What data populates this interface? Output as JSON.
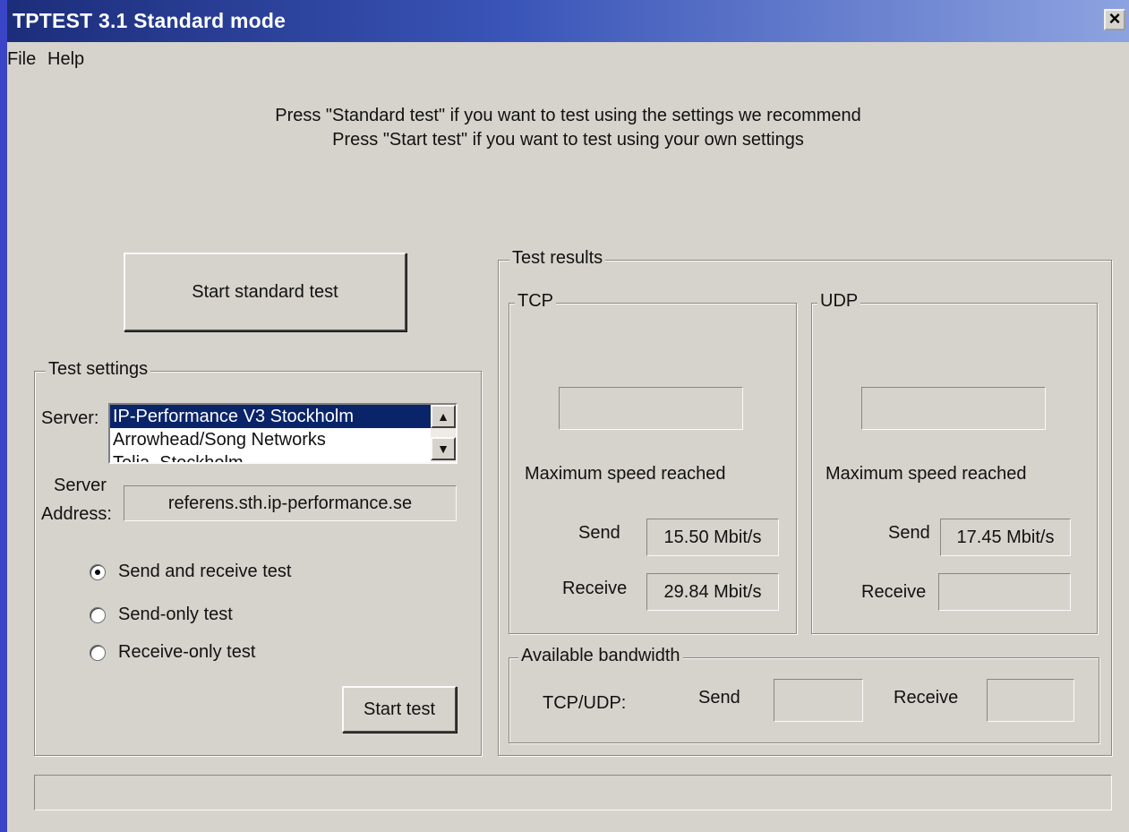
{
  "window": {
    "title": "TPTEST 3.1 Standard mode",
    "close_label": "×"
  },
  "menu": {
    "file": "File",
    "help": "Help"
  },
  "instructions": [
    "Press \"Standard test\" if you want to test using the settings we recommend",
    "Press \"Start test\" if you want to test using your own settings"
  ],
  "standard_button": "Start standard test",
  "settings": {
    "legend": "Test settings",
    "server_label": "Server:",
    "servers": [
      "IP-Performance V3 Stockholm",
      "Arrowhead/Song Networks",
      "Telia, Stockholm"
    ],
    "selected_server": "IP-Performance V3 Stockholm",
    "address_label_1": "Server",
    "address_label_2": "Address:",
    "address_value": "referens.sth.ip-performance.se",
    "radio": [
      {
        "label": "Send and receive test",
        "checked": true
      },
      {
        "label": "Send-only test",
        "checked": false
      },
      {
        "label": "Receive-only test",
        "checked": false
      }
    ],
    "start_button": "Start test"
  },
  "results": {
    "legend": "Test results",
    "tcp": {
      "legend": "TCP",
      "max_label": "Maximum speed reached",
      "send_label": "Send",
      "send_value": "15.50 Mbit/s",
      "receive_label": "Receive",
      "receive_value": "29.84 Mbit/s"
    },
    "udp": {
      "legend": "UDP",
      "max_label": "Maximum speed reached",
      "send_label": "Send",
      "send_value": "17.45 Mbit/s",
      "receive_label": "Receive",
      "receive_value": ""
    },
    "bandwidth": {
      "legend": "Available bandwidth",
      "proto_label": "TCP/UDP:",
      "send_label": "Send",
      "receive_label": "Receive"
    }
  },
  "status_bar": ""
}
